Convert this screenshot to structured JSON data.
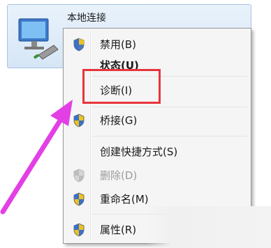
{
  "connection": {
    "title": "本地连接",
    "icon": "network-adapter-icon"
  },
  "context_menu": {
    "items": [
      {
        "label": "禁用(B)",
        "icon": "uac-shield-icon",
        "bold": false,
        "disabled": false
      },
      {
        "label": "状态(U)",
        "icon": null,
        "bold": true,
        "disabled": false
      },
      {
        "label": "诊断(I)",
        "icon": null,
        "bold": false,
        "disabled": false,
        "highlighted": true
      },
      {
        "label": "桥接(G)",
        "icon": "uac-shield-icon",
        "bold": false,
        "disabled": false
      },
      {
        "label": "创建快捷方式(S)",
        "icon": null,
        "bold": false,
        "disabled": false
      },
      {
        "label": "删除(D)",
        "icon": "uac-shield-icon",
        "bold": false,
        "disabled": true
      },
      {
        "label": "重命名(M)",
        "icon": "uac-shield-icon",
        "bold": false,
        "disabled": false
      },
      {
        "label": "属性(R)",
        "icon": "uac-shield-icon",
        "bold": false,
        "disabled": false
      }
    ]
  },
  "annotation": {
    "highlight_color": "#e8343b",
    "arrow_color": "#e23fe4"
  }
}
